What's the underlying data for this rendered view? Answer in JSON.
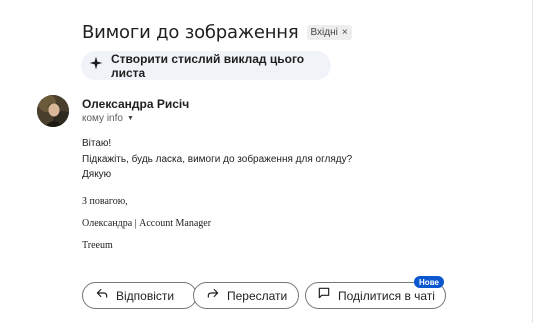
{
  "email": {
    "subject": "Вимоги до зображення",
    "label_chip": "Вхідні",
    "label_chip_remove": "×",
    "summary_label": "Створити стислий виклад цього листа",
    "sender_name": "Олександра Рисіч",
    "recipient_line": "кому info",
    "body_lines": [
      "Вітаю!",
      "Підкажіть, будь ласка, вимоги до зображення для огляду?",
      "Дякую"
    ],
    "signature": {
      "greeting": "З повагою,",
      "name_title": "Олександра | Account Manager",
      "company": "Treeum"
    }
  },
  "actions": {
    "reply": "Відповісти",
    "forward": "Переслати",
    "share_chat": "Поділитися в чаті",
    "new_badge": "Нове"
  },
  "icons": {
    "sparkle": "sparkle-icon",
    "reply": "reply-arrow-icon",
    "forward": "forward-arrow-icon",
    "chat": "chat-bubble-icon",
    "caret": "caret-down-icon"
  },
  "colors": {
    "summary_bg": "#f0f4f9",
    "badge_blue": "#0b57d0",
    "chip_bg": "#eeeeee"
  }
}
